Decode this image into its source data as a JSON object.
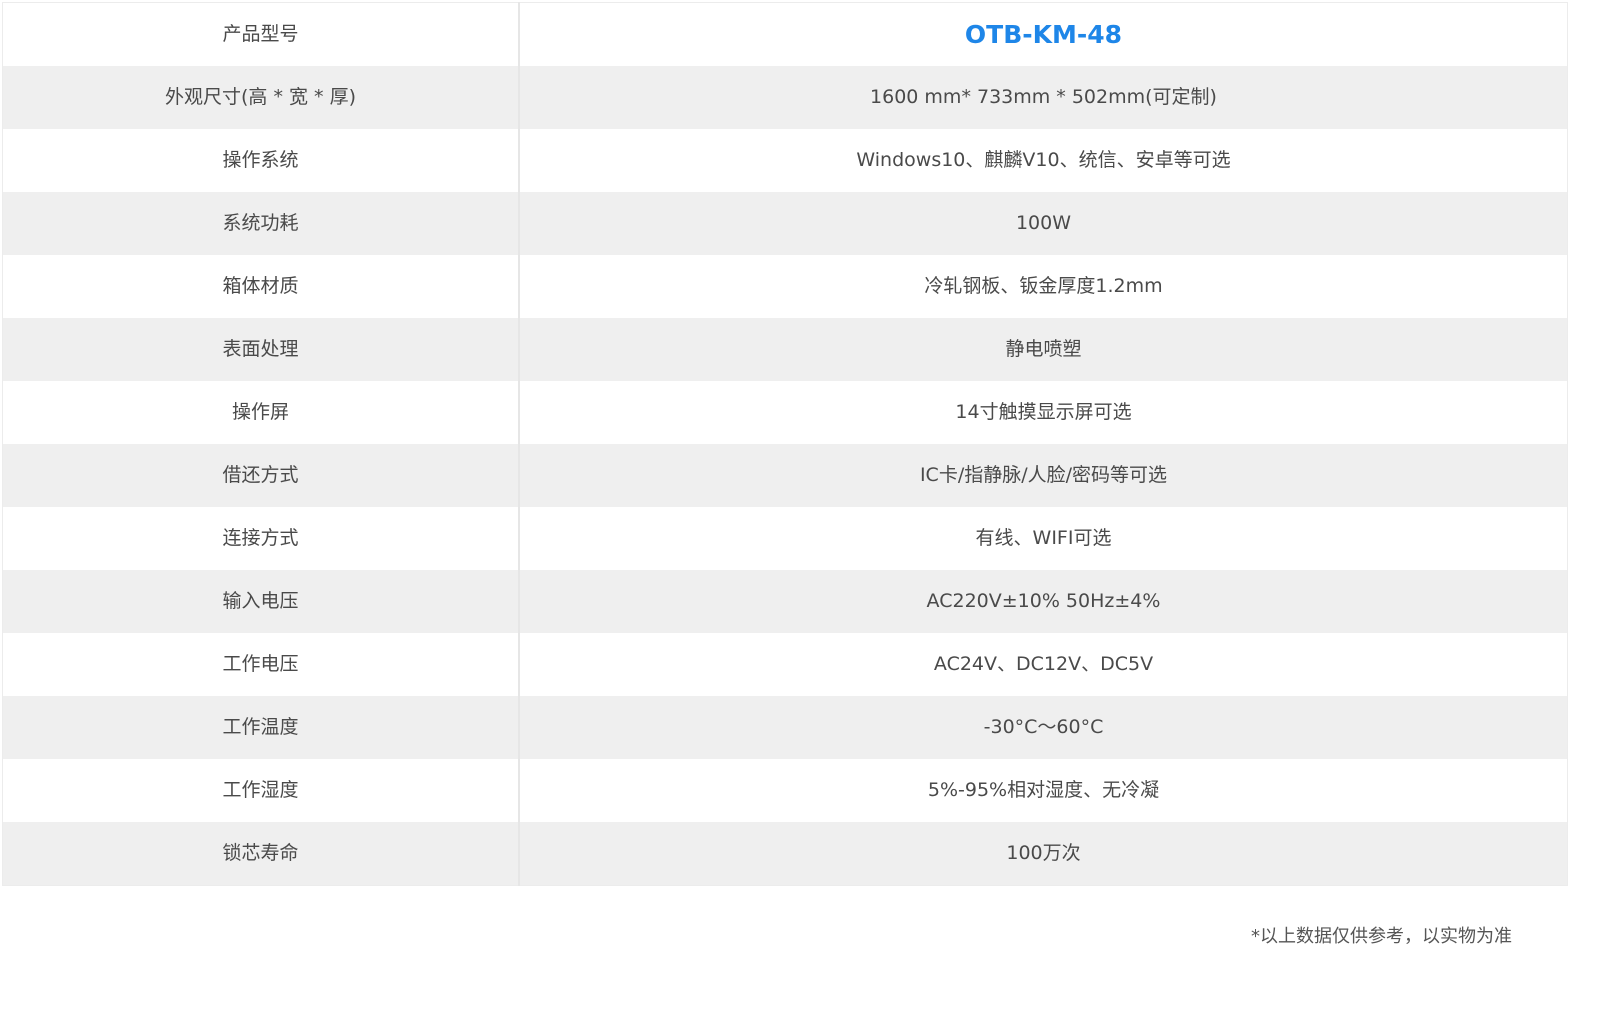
{
  "specs": {
    "rows": [
      {
        "label": "产品型号",
        "value": "OTB-KM-48"
      },
      {
        "label": "外观尺寸(高 * 宽 * 厚)",
        "value": "1600 mm* 733mm * 502mm(可定制)"
      },
      {
        "label": "操作系统",
        "value": "Windows10、麒麟V10、统信、安卓等可选"
      },
      {
        "label": "系统功耗",
        "value": "100W"
      },
      {
        "label": "箱体材质",
        "value": "冷轧钢板、钣金厚度1.2mm"
      },
      {
        "label": "表面处理",
        "value": "静电喷塑"
      },
      {
        "label": "操作屏",
        "value": "14寸触摸显示屏可选"
      },
      {
        "label": "借还方式",
        "value": "IC卡/指静脉/人脸/密码等可选"
      },
      {
        "label": "连接方式",
        "value": "有线、WIFI可选"
      },
      {
        "label": "输入电压",
        "value": "AC220V±10%  50Hz±4%"
      },
      {
        "label": "工作电压",
        "value": "AC24V、DC12V、DC5V"
      },
      {
        "label": "工作温度",
        "value": "-30°C～60°C"
      },
      {
        "label": "工作湿度",
        "value": "5%-95%相对湿度、无冷凝"
      },
      {
        "label": "锁芯寿命",
        "value": "100万次"
      }
    ]
  },
  "footnote": "*以上数据仅供参考，以实物为准",
  "colors": {
    "accent": "#1e86e8",
    "row_alt": "#efefef",
    "text": "#4a4a4a"
  }
}
